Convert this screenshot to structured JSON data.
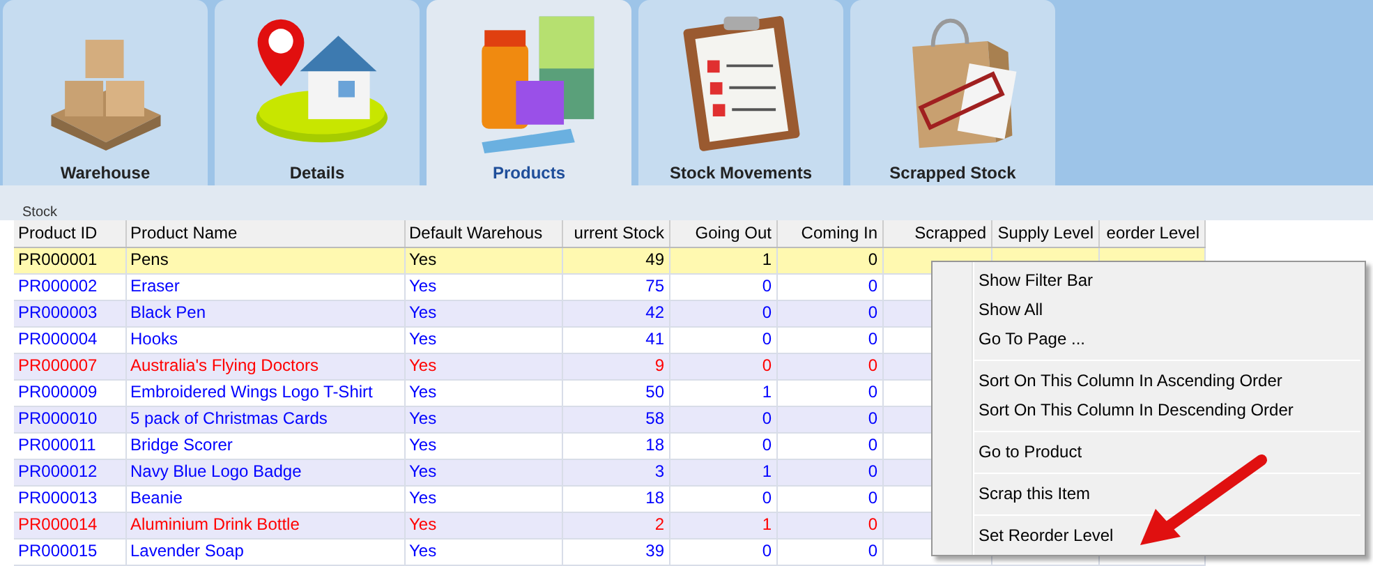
{
  "tabs": [
    {
      "label": "Warehouse",
      "kind": "boxes",
      "selected": false
    },
    {
      "label": "Details",
      "kind": "house",
      "selected": false
    },
    {
      "label": "Products",
      "kind": "products",
      "selected": true
    },
    {
      "label": "Stock Movements",
      "kind": "clipboard",
      "selected": false
    },
    {
      "label": "Scrapped Stock",
      "kind": "bag",
      "selected": false
    }
  ],
  "section_title": "Stock",
  "table": {
    "columns": [
      "Product ID",
      "Product Name",
      "Default Warehous",
      "urrent Stock",
      "Going Out",
      "Coming In",
      "Scrapped",
      "Supply Level",
      "eorder Level"
    ],
    "rows": [
      {
        "color": "#000000",
        "selected": true,
        "cells": [
          "PR000001",
          "Pens",
          "Yes",
          "49",
          "1",
          "0"
        ]
      },
      {
        "color": "#0000ff",
        "selected": false,
        "cells": [
          "PR000002",
          "Eraser",
          "Yes",
          "75",
          "0",
          "0"
        ]
      },
      {
        "color": "#0000ff",
        "selected": false,
        "cells": [
          "PR000003",
          "Black Pen",
          "Yes",
          "42",
          "0",
          "0"
        ]
      },
      {
        "color": "#0000ff",
        "selected": false,
        "cells": [
          "PR000004",
          "Hooks",
          "Yes",
          "41",
          "0",
          "0"
        ]
      },
      {
        "color": "#ff0000",
        "selected": false,
        "cells": [
          "PR000007",
          "Australia's Flying Doctors",
          "Yes",
          "9",
          "0",
          "0"
        ]
      },
      {
        "color": "#0000ff",
        "selected": false,
        "cells": [
          "PR000009",
          "Embroidered Wings Logo T-Shirt",
          "Yes",
          "50",
          "1",
          "0"
        ]
      },
      {
        "color": "#0000ff",
        "selected": false,
        "cells": [
          "PR000010",
          "5 pack of Christmas Cards",
          "Yes",
          "58",
          "0",
          "0"
        ]
      },
      {
        "color": "#0000ff",
        "selected": false,
        "cells": [
          "PR000011",
          "Bridge Scorer",
          "Yes",
          "18",
          "0",
          "0"
        ]
      },
      {
        "color": "#0000ff",
        "selected": false,
        "cells": [
          "PR000012",
          "Navy Blue Logo Badge",
          "Yes",
          "3",
          "1",
          "0"
        ]
      },
      {
        "color": "#0000ff",
        "selected": false,
        "cells": [
          "PR000013",
          "Beanie",
          "Yes",
          "18",
          "0",
          "0"
        ]
      },
      {
        "color": "#ff0000",
        "selected": false,
        "cells": [
          "PR000014",
          "Aluminium Drink Bottle",
          "Yes",
          "2",
          "1",
          "0"
        ]
      },
      {
        "color": "#0000ff",
        "selected": false,
        "cells": [
          "PR000015",
          "Lavender Soap",
          "Yes",
          "39",
          "0",
          "0"
        ]
      }
    ]
  },
  "context_menu": [
    {
      "kind": "item",
      "label": "Show Filter Bar"
    },
    {
      "kind": "item",
      "label": "Show All"
    },
    {
      "kind": "item",
      "label": "Go To Page ..."
    },
    {
      "kind": "separator"
    },
    {
      "kind": "item",
      "label": "Sort On This Column In Ascending Order"
    },
    {
      "kind": "item",
      "label": "Sort On This Column In Descending Order"
    },
    {
      "kind": "separator"
    },
    {
      "kind": "item",
      "label": "Go to Product"
    },
    {
      "kind": "separator"
    },
    {
      "kind": "item",
      "label": "Scrap this Item"
    },
    {
      "kind": "separator"
    },
    {
      "kind": "item",
      "label": "Set Reorder Level"
    }
  ]
}
